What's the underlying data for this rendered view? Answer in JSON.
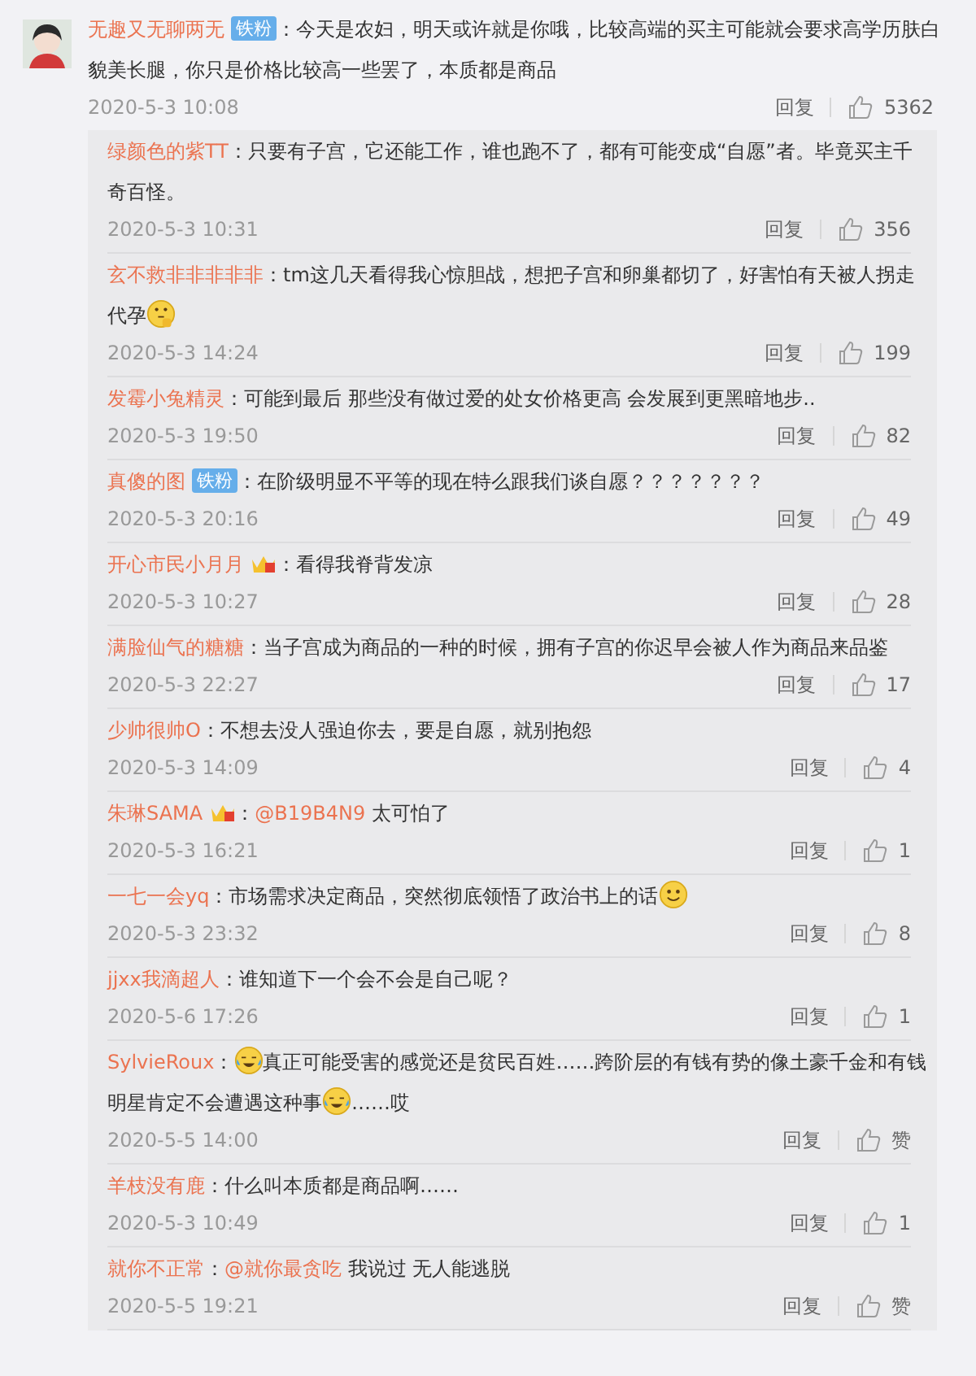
{
  "main_comment": {
    "username": "无趣又无聊两无",
    "badge": {
      "kind": "fan",
      "label": "铁粉"
    },
    "content": [
      {
        "kind": "text",
        "text": "：今天是农妇，明天或许就是你哦，比较高端的买主可能就会要求高学历肤白貌美长腿，你只是价格比较高一些罢了，本质都是商品"
      }
    ],
    "time": "2020-5-3 10:08",
    "reply_label": "回复",
    "likes": "5362"
  },
  "replies": [
    {
      "username": "绿颜色的紫TT",
      "content": [
        {
          "kind": "text",
          "text": "：只要有子宫，它还能工作，谁也跑不了，都有可能变成“自愿”者。毕竟买主千奇百怪。"
        }
      ],
      "time": "2020-5-3 10:31",
      "reply_label": "回复",
      "likes": "356"
    },
    {
      "username": "玄不救非非非非非",
      "content": [
        {
          "kind": "text",
          "text": "：tm这几天看得我心惊胆战，想把子宫和卵巢都切了，好害怕有天被人拐走代孕"
        },
        {
          "kind": "ponder"
        }
      ],
      "time": "2020-5-3 14:24",
      "reply_label": "回复",
      "likes": "199"
    },
    {
      "username": "发霉小兔精灵",
      "content": [
        {
          "kind": "text",
          "text": "：可能到最后 那些没有做过爱的处女价格更高 会发展到更黑暗地步.."
        }
      ],
      "time": "2020-5-3 19:50",
      "reply_label": "回复",
      "likes": "82"
    },
    {
      "username": "真傻的图",
      "badge": {
        "kind": "fan",
        "label": "铁粉"
      },
      "content": [
        {
          "kind": "text",
          "text": "：在阶级明显不平等的现在特么跟我们谈自愿？？？？？？？"
        }
      ],
      "time": "2020-5-3 20:16",
      "reply_label": "回复",
      "likes": "49"
    },
    {
      "username": "开心市民小月月",
      "badge": {
        "kind": "crown"
      },
      "content": [
        {
          "kind": "text",
          "text": "：看得我脊背发凉"
        }
      ],
      "time": "2020-5-3 10:27",
      "reply_label": "回复",
      "likes": "28"
    },
    {
      "username": "满脸仙气的糖糖",
      "content": [
        {
          "kind": "text",
          "text": "：当子宫成为商品的一种的时候，拥有子宫的你迟早会被人作为商品来品鉴"
        }
      ],
      "time": "2020-5-3 22:27",
      "reply_label": "回复",
      "likes": "17"
    },
    {
      "username": "少帅很帅O",
      "content": [
        {
          "kind": "text",
          "text": "：不想去没人强迫你去，要是自愿，就别抱怨"
        }
      ],
      "time": "2020-5-3 14:09",
      "reply_label": "回复",
      "likes": "4"
    },
    {
      "username": "朱琳SAMA",
      "badge": {
        "kind": "crown"
      },
      "content": [
        {
          "kind": "text",
          "text": "："
        },
        {
          "kind": "mention",
          "text": "@B19B4N9"
        },
        {
          "kind": "text",
          "text": " 太可怕了"
        }
      ],
      "time": "2020-5-3 16:21",
      "reply_label": "回复",
      "likes": "1"
    },
    {
      "username": "一七一会yq",
      "content": [
        {
          "kind": "text",
          "text": "：市场需求决定商品，突然彻底领悟了政治书上的话"
        },
        {
          "kind": "smiley"
        }
      ],
      "time": "2020-5-3 23:32",
      "reply_label": "回复",
      "likes": "8"
    },
    {
      "username": "jjxx我滴超人",
      "content": [
        {
          "kind": "text",
          "text": "：谁知道下一个会不会是自己呢？"
        }
      ],
      "time": "2020-5-6 17:26",
      "reply_label": "回复",
      "likes": "1"
    },
    {
      "username": "SylvieRoux",
      "content": [
        {
          "kind": "text",
          "text": "："
        },
        {
          "kind": "laughcry"
        },
        {
          "kind": "text",
          "text": "真正可能受害的感觉还是贫民百姓……跨阶层的有钱有势的像土豪千金和有钱明星肯定不会遭遇这种事"
        },
        {
          "kind": "laughcry"
        },
        {
          "kind": "text",
          "text": "……哎"
        }
      ],
      "time": "2020-5-5 14:00",
      "reply_label": "回复",
      "likes": "赞"
    },
    {
      "username": "羊枝没有鹿",
      "content": [
        {
          "kind": "text",
          "text": "：什么叫本质都是商品啊……"
        }
      ],
      "time": "2020-5-3 10:49",
      "reply_label": "回复",
      "likes": "1"
    },
    {
      "username": "就你不正常",
      "content": [
        {
          "kind": "text",
          "text": "："
        },
        {
          "kind": "mention",
          "text": "@就你最贪吃"
        },
        {
          "kind": "text",
          "text": " 我说过 无人能逃脱"
        }
      ],
      "time": "2020-5-5 19:21",
      "reply_label": "回复",
      "likes": "赞"
    }
  ]
}
